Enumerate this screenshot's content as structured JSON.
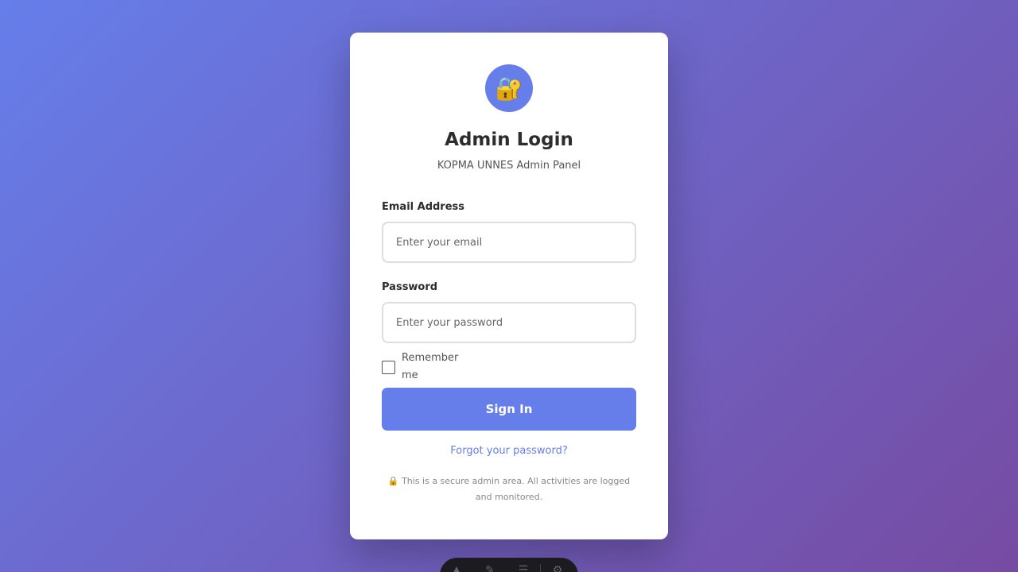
{
  "login": {
    "icon": "lock-with-key-icon",
    "title": "Admin Login",
    "subtitle": "KOPMA UNNES Admin Panel",
    "email_label": "Email Address",
    "email_placeholder": "Enter your email",
    "email_value": "",
    "password_label": "Password",
    "password_placeholder": "Enter your password",
    "password_value": "",
    "remember_label": "Remember me",
    "remember_checked": false,
    "submit_label": "Sign In",
    "forgot_label": "Forgot your password?",
    "security_note_icon": "lock-icon",
    "security_note": "This is a secure admin area. All activities are logged and monitored."
  },
  "colors": {
    "accent": "#667eea",
    "gradient_start": "#667eea",
    "gradient_end": "#764ba2"
  }
}
